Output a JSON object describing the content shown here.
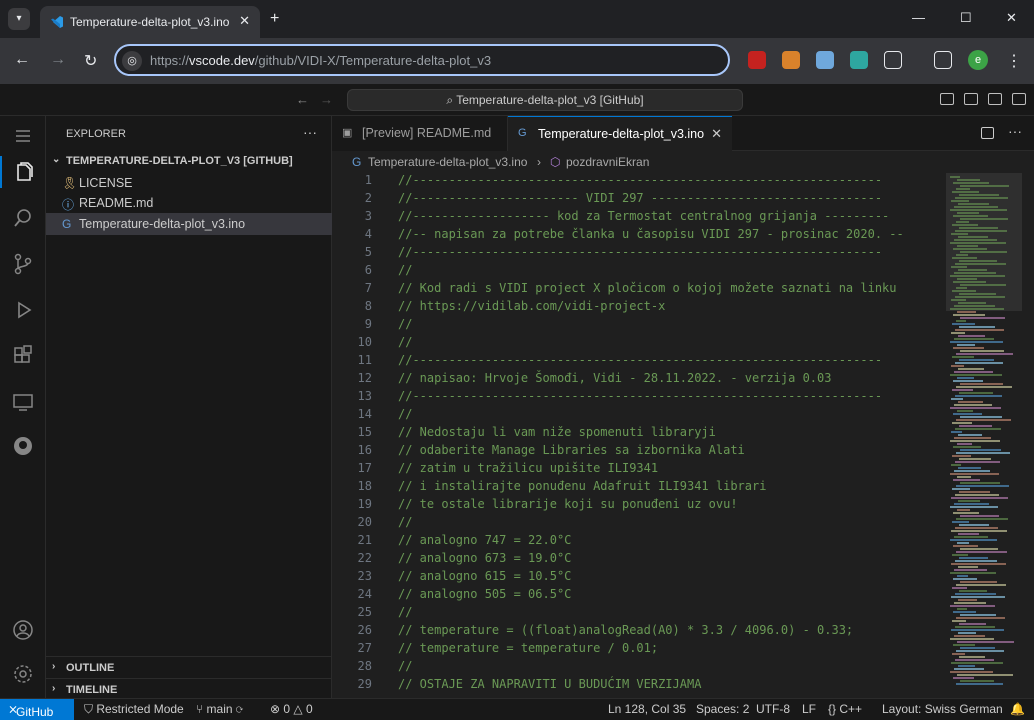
{
  "browser": {
    "tab_title": "Temperature-delta-plot_v3.ino",
    "url_prefix": "https://",
    "url_host": "vscode.dev",
    "url_path": "/github/VIDI-X/Temperature-delta-plot_v3",
    "profile_initial": "e"
  },
  "titlebar": {
    "command_center": "Temperature-delta-plot_v3 [GitHub]"
  },
  "explorer": {
    "title": "EXPLORER",
    "repo_label": "TEMPERATURE-DELTA-PLOT_V3 [GITHUB]",
    "files": [
      {
        "name": "LICENSE",
        "icon": "license-icon"
      },
      {
        "name": "README.md",
        "icon": "info-icon"
      },
      {
        "name": "Temperature-delta-plot_v3.ino",
        "icon": "cpp-file-icon"
      }
    ],
    "outline_label": "OUTLINE",
    "timeline_label": "TIMELINE"
  },
  "editor": {
    "tab_preview": "[Preview] README.md",
    "tab_active": "Temperature-delta-plot_v3.ino",
    "breadcrumb_file": "Temperature-delta-plot_v3.ino",
    "breadcrumb_symbol": "pozdravniEkran",
    "lines": [
      {
        "n": "1",
        "text": "//-----------------------------------------------------------------"
      },
      {
        "n": "2",
        "text": "//----------------------- VIDI 297 --------------------------------"
      },
      {
        "n": "3",
        "text": "//------------------- kod za Termostat centralnog grijanja ---------"
      },
      {
        "n": "4",
        "text": "//-- napisan za potrebe članka u časopisu VIDI 297 - prosinac 2020. --"
      },
      {
        "n": "5",
        "text": "//-----------------------------------------------------------------"
      },
      {
        "n": "6",
        "text": "//"
      },
      {
        "n": "7",
        "text": "// Kod radi s VIDI project X pločicom o kojoj možete saznati na linku"
      },
      {
        "n": "8",
        "text": "// https://vidilab.com/vidi-project-x"
      },
      {
        "n": "9",
        "text": "//"
      },
      {
        "n": "10",
        "text": "//"
      },
      {
        "n": "11",
        "text": "//-----------------------------------------------------------------"
      },
      {
        "n": "12",
        "text": "// napisao: Hrvoje Šomođi, Vidi - 28.11.2022. - verzija 0.03"
      },
      {
        "n": "13",
        "text": "//-----------------------------------------------------------------"
      },
      {
        "n": "14",
        "text": "//"
      },
      {
        "n": "15",
        "text": "// Nedostaju li vam niže spomenuti libraryji"
      },
      {
        "n": "16",
        "text": "// odaberite Manage Libraries sa izbornika Alati"
      },
      {
        "n": "17",
        "text": "// zatim u tražilicu upišite ILI9341"
      },
      {
        "n": "18",
        "text": "// i instalirajte ponuđenu Adafruit ILI9341 librari"
      },
      {
        "n": "19",
        "text": "// te ostale librarije koji su ponuđeni uz ovu!"
      },
      {
        "n": "20",
        "text": "//"
      },
      {
        "n": "21",
        "text": "// analogno 747 = 22.0°C"
      },
      {
        "n": "22",
        "text": "// analogno 673 = 19.0°C"
      },
      {
        "n": "23",
        "text": "// analogno 615 = 10.5°C"
      },
      {
        "n": "24",
        "text": "// analogno 505 = 06.5°C"
      },
      {
        "n": "25",
        "text": "//"
      },
      {
        "n": "26",
        "text": "// temperature = ((float)analogRead(A0) * 3.3 / 4096.0) - 0.33;"
      },
      {
        "n": "27",
        "text": "// temperature = temperature / 0.01;"
      },
      {
        "n": "28",
        "text": "//"
      },
      {
        "n": "29",
        "text": "// OSTAJE ZA NAPRAVITI U BUDUĆIM VERZIJAMA"
      }
    ]
  },
  "statusbar": {
    "remote": "GitHub",
    "restricted": "Restricted Mode",
    "branch": "main",
    "errors": "0",
    "warnings": "0",
    "position": "Ln 128, Col 35",
    "spaces": "Spaces: 2",
    "encoding": "UTF-8",
    "eol": "LF",
    "language": "C++",
    "layout": "Layout: Swiss German"
  },
  "colors": {
    "accent": "#0078d4",
    "comment": "#6a9955",
    "editor_bg": "#1f1f1f",
    "sidebar_bg": "#181818"
  }
}
